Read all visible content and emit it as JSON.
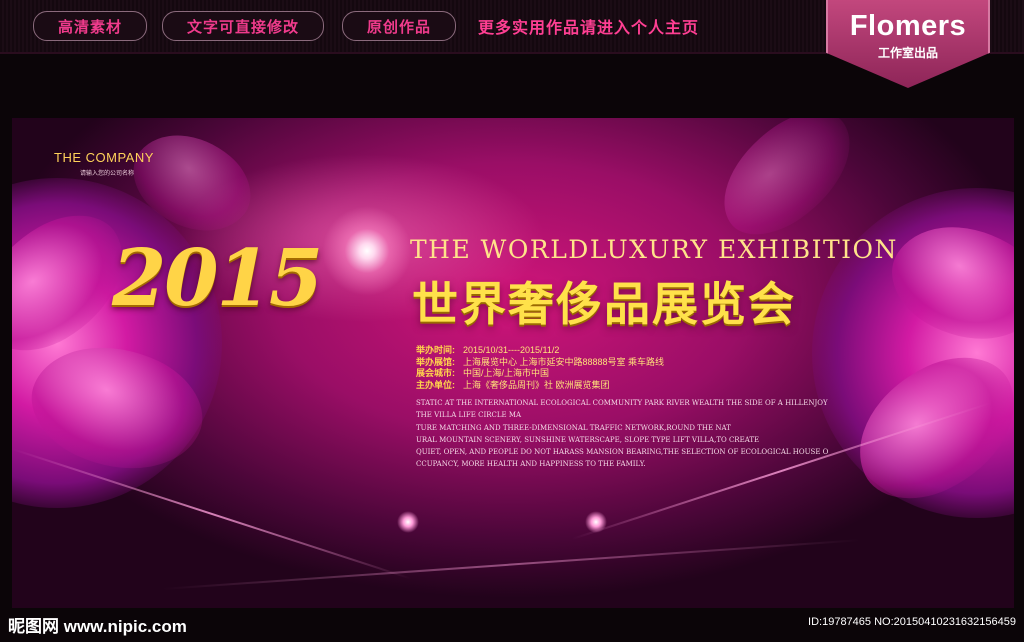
{
  "topbar": {
    "tags": [
      "高清素材",
      "文字可直接修改",
      "原创作品"
    ],
    "promo": "更多实用作品请进入个人主页",
    "logo": {
      "title": "Flomers",
      "subtitle": "工作室出品"
    }
  },
  "banner": {
    "company": "THE COMPANY",
    "company_sub": "请输入您的公司名称",
    "year": "2015",
    "en_title": "THE WORLDLUXURY EXHIBITION",
    "cn_title": "世界奢侈品展览会",
    "info": [
      {
        "label": "举办时间:",
        "value": "2015/10/31----2015/11/2"
      },
      {
        "label": "举办展馆:",
        "value": "上海展览中心 上海市延安中路88888号室  乘车路线"
      },
      {
        "label": "展会城市:",
        "value": "中国/上海/上海市中国"
      },
      {
        "label": "主办单位:",
        "value": "上海《奢侈品周刊》社 欧洲展览集团"
      }
    ],
    "description": [
      "STATIC AT THE INTERNATIONAL ECOLOGICAL COMMUNITY PARK RIVER WEALTH THE SIDE OF A HILLENJOY",
      "THE VILLA LIFE CIRCLE MA",
      "TURE MATCHING AND THREE-DIMENSIONAL TRAFFIC NETWORK,ROUND THE NAT",
      "URAL MOUNTAIN SCENERY, SUNSHINE WATERSCAPE, SLOPE TYPE LIFT VILLA,TO CREATE",
      "QUIET, OPEN, AND PEOPLE DO NOT HARASS MANSION BEARING,THE SELECTION OF ECOLOGICAL HOUSE O",
      "CCUPANCY, MORE HEALTH AND HAPPINESS TO THE FAMILY."
    ]
  },
  "watermark": {
    "left": "昵图网 www.nipic.com",
    "right": "ID:19787465 NO:20150410231632156459"
  }
}
